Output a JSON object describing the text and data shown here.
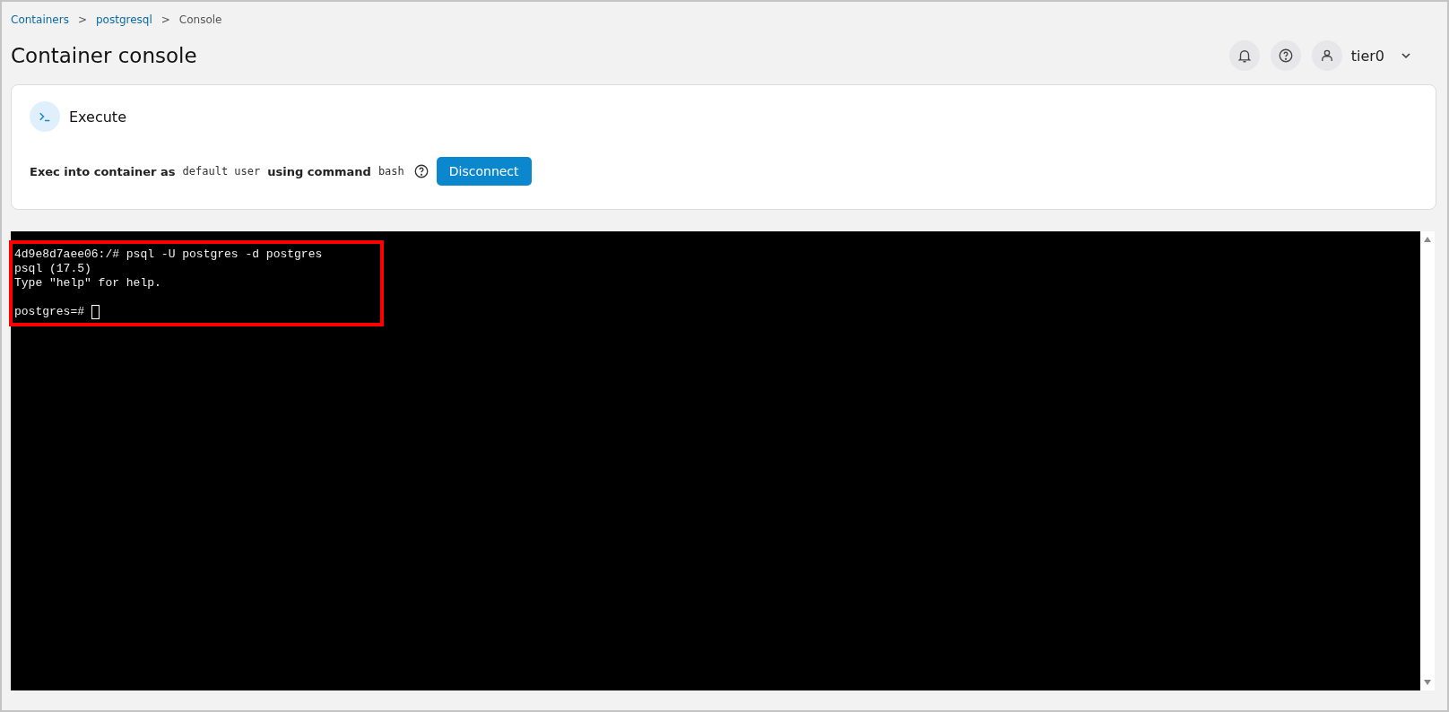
{
  "breadcrumb": [
    {
      "label": "Containers",
      "link": true
    },
    {
      "label": "postgresql",
      "link": true
    },
    {
      "label": "Console",
      "link": false
    }
  ],
  "breadcrumb_separator": ">",
  "title": "Container console",
  "user": {
    "name": "tier0"
  },
  "execute": {
    "heading": "Execute",
    "parts": [
      {
        "kind": "label",
        "text": "Exec into container as"
      },
      {
        "kind": "code",
        "text": "default user"
      },
      {
        "kind": "label",
        "text": "using command"
      },
      {
        "kind": "code",
        "text": "bash"
      }
    ],
    "button": "Disconnect"
  },
  "terminal": {
    "highlighted": true,
    "lines": [
      "4d9e8d7aee06:/# psql -U postgres -d postgres",
      "psql (17.5)",
      "Type \"help\" for help."
    ],
    "prompt": "postgres=#",
    "cursor": true
  }
}
